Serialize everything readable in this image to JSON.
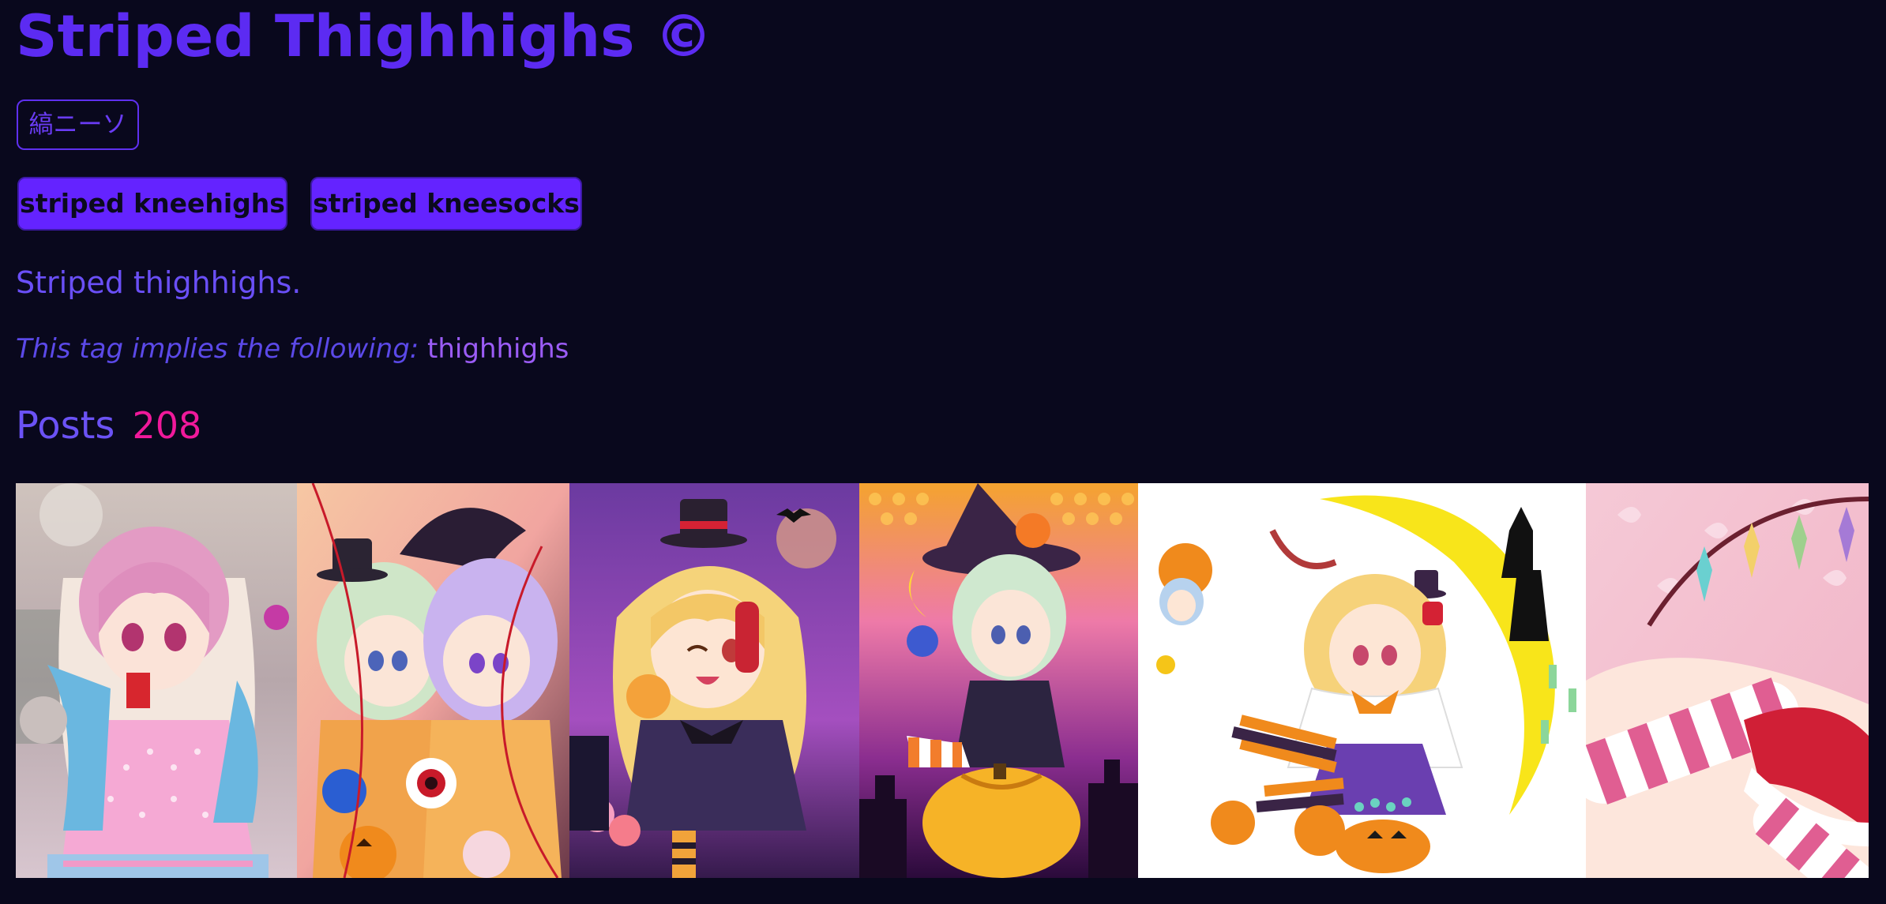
{
  "tag": {
    "title": "Striped Thighhighs ©",
    "japanese_name": "縞ニーソ",
    "aliases": [
      "striped kneehighs",
      "striped kneesocks"
    ],
    "description": "Striped thighhighs.",
    "implies_label": "This tag implies the following:",
    "implies_tag": "thighhighs"
  },
  "posts": {
    "heading": "Posts",
    "count": "208"
  },
  "thumbnails": [
    {
      "alt": "pink-haired girl in hoodie holding drink",
      "icon": "image-thumbnail"
    },
    {
      "alt": "two girls with heart cords and pumpkin",
      "icon": "image-thumbnail"
    },
    {
      "alt": "blonde girl in witch mini hat under moon",
      "icon": "image-thumbnail"
    },
    {
      "alt": "green-haired witch on jack-o-lantern",
      "icon": "image-thumbnail"
    },
    {
      "alt": "girl sitting on crescent moon with pumpkins",
      "icon": "image-thumbnail"
    },
    {
      "alt": "striped stockings with crystal wings",
      "icon": "image-thumbnail"
    }
  ],
  "colors": {
    "background": "#09081d",
    "accent": "#6423ff",
    "title": "#5c2bf2",
    "count": "#f0199b",
    "link": "#9b5cf6"
  }
}
